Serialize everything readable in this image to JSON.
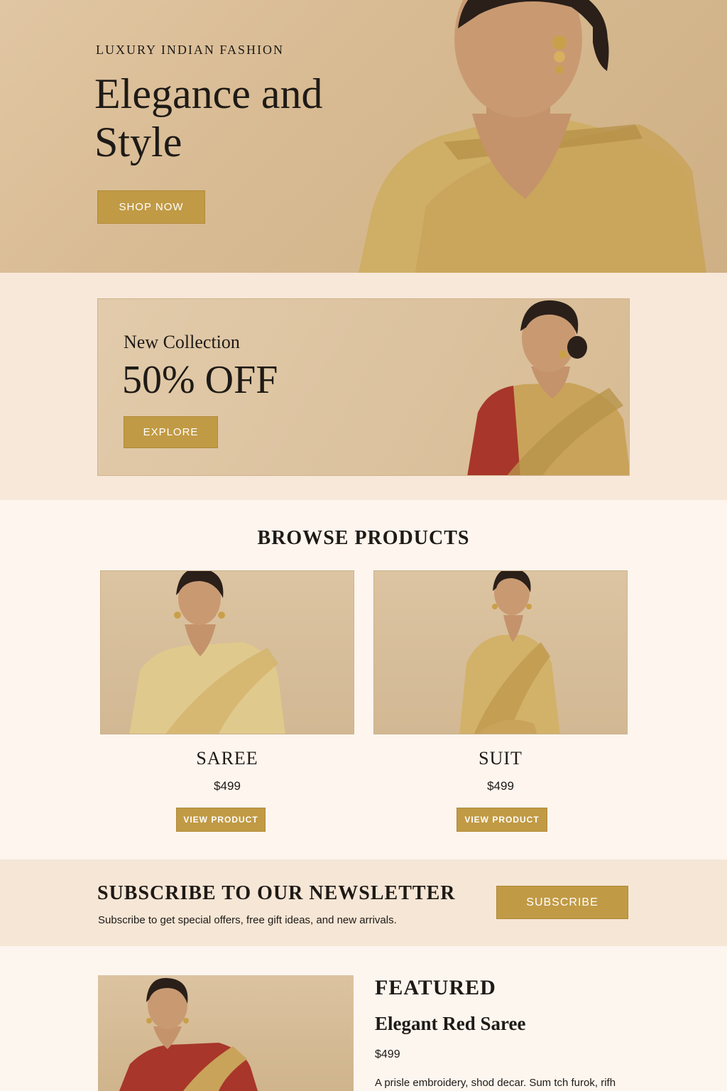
{
  "hero": {
    "eyebrow": "LUXURY INDIAN FASHION",
    "title": "Elegance and Style",
    "cta_label": "SHOP NOW"
  },
  "promo": {
    "subtitle": "New Collection",
    "headline": "50% OFF",
    "cta_label": "EXPLORE"
  },
  "browse": {
    "title": "BROWSE PRODUCTS",
    "products": [
      {
        "name": "SAREE",
        "price": "$499",
        "cta_label": "VIEW PRODUCT"
      },
      {
        "name": "SUIT",
        "price": "$499",
        "cta_label": "VIEW PRODUCT"
      }
    ]
  },
  "newsletter": {
    "title": "SUBSCRIBE TO OUR NEWSLETTER",
    "text": "Subscribe to get special offers, free gift ideas, and new arrivals.",
    "cta_label": "SUBSCRIBE"
  },
  "featured": {
    "label": "FEATURED",
    "name": "Elegant Red Saree",
    "price": "$499",
    "description": "A prisle embroidery, shod decar. Sum tch furok, rifh"
  },
  "colors": {
    "accent_gold": "#c19a45",
    "background": "#fdf6ef",
    "band": "#f6e6d6"
  }
}
